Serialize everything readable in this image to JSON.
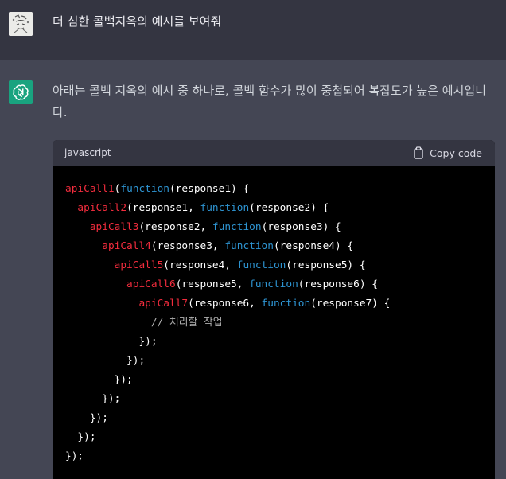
{
  "user_message": {
    "text": "더 심한 콜백지옥의 예시를 보여줘"
  },
  "assistant_message": {
    "text": "아래는 콜백 지옥의 예시 중 하나로, 콜백 함수가 많이 중첩되어 복잡도가 높은 예시입니다."
  },
  "code_block": {
    "language": "javascript",
    "copy_label": "Copy code",
    "lines": [
      [
        {
          "t": "apiCall1",
          "c": "fn"
        },
        {
          "t": "(",
          "c": "pl"
        },
        {
          "t": "function",
          "c": "kw"
        },
        {
          "t": "(response1) {",
          "c": "pl"
        }
      ],
      [
        {
          "t": "  ",
          "c": "pl"
        },
        {
          "t": "apiCall2",
          "c": "fn"
        },
        {
          "t": "(response1, ",
          "c": "pl"
        },
        {
          "t": "function",
          "c": "kw"
        },
        {
          "t": "(response2) {",
          "c": "pl"
        }
      ],
      [
        {
          "t": "    ",
          "c": "pl"
        },
        {
          "t": "apiCall3",
          "c": "fn"
        },
        {
          "t": "(response2, ",
          "c": "pl"
        },
        {
          "t": "function",
          "c": "kw"
        },
        {
          "t": "(response3) {",
          "c": "pl"
        }
      ],
      [
        {
          "t": "      ",
          "c": "pl"
        },
        {
          "t": "apiCall4",
          "c": "fn"
        },
        {
          "t": "(response3, ",
          "c": "pl"
        },
        {
          "t": "function",
          "c": "kw"
        },
        {
          "t": "(response4) {",
          "c": "pl"
        }
      ],
      [
        {
          "t": "        ",
          "c": "pl"
        },
        {
          "t": "apiCall5",
          "c": "fn"
        },
        {
          "t": "(response4, ",
          "c": "pl"
        },
        {
          "t": "function",
          "c": "kw"
        },
        {
          "t": "(response5) {",
          "c": "pl"
        }
      ],
      [
        {
          "t": "          ",
          "c": "pl"
        },
        {
          "t": "apiCall6",
          "c": "fn"
        },
        {
          "t": "(response5, ",
          "c": "pl"
        },
        {
          "t": "function",
          "c": "kw"
        },
        {
          "t": "(response6) {",
          "c": "pl"
        }
      ],
      [
        {
          "t": "            ",
          "c": "pl"
        },
        {
          "t": "apiCall7",
          "c": "fn"
        },
        {
          "t": "(response6, ",
          "c": "pl"
        },
        {
          "t": "function",
          "c": "kw"
        },
        {
          "t": "(response7) {",
          "c": "pl"
        }
      ],
      [
        {
          "t": "              ",
          "c": "pl"
        },
        {
          "t": "// 처리할 작업",
          "c": "cm"
        }
      ],
      [
        {
          "t": "            });",
          "c": "pl"
        }
      ],
      [
        {
          "t": "          });",
          "c": "pl"
        }
      ],
      [
        {
          "t": "        });",
          "c": "pl"
        }
      ],
      [
        {
          "t": "      });",
          "c": "pl"
        }
      ],
      [
        {
          "t": "    });",
          "c": "pl"
        }
      ],
      [
        {
          "t": "  });",
          "c": "pl"
        }
      ],
      [
        {
          "t": "});",
          "c": "pl"
        }
      ]
    ]
  },
  "colors": {
    "user_bg": "#343541",
    "assistant_bg": "#444654",
    "bot_avatar": "#19a37f",
    "code_fn": "#f22c3d",
    "code_keyword": "#2e95d3",
    "code_comment": "#b0b0b0"
  },
  "icons": {
    "user_avatar": "user-avatar-image",
    "bot_avatar": "openai-logo-icon",
    "copy": "clipboard-icon"
  }
}
